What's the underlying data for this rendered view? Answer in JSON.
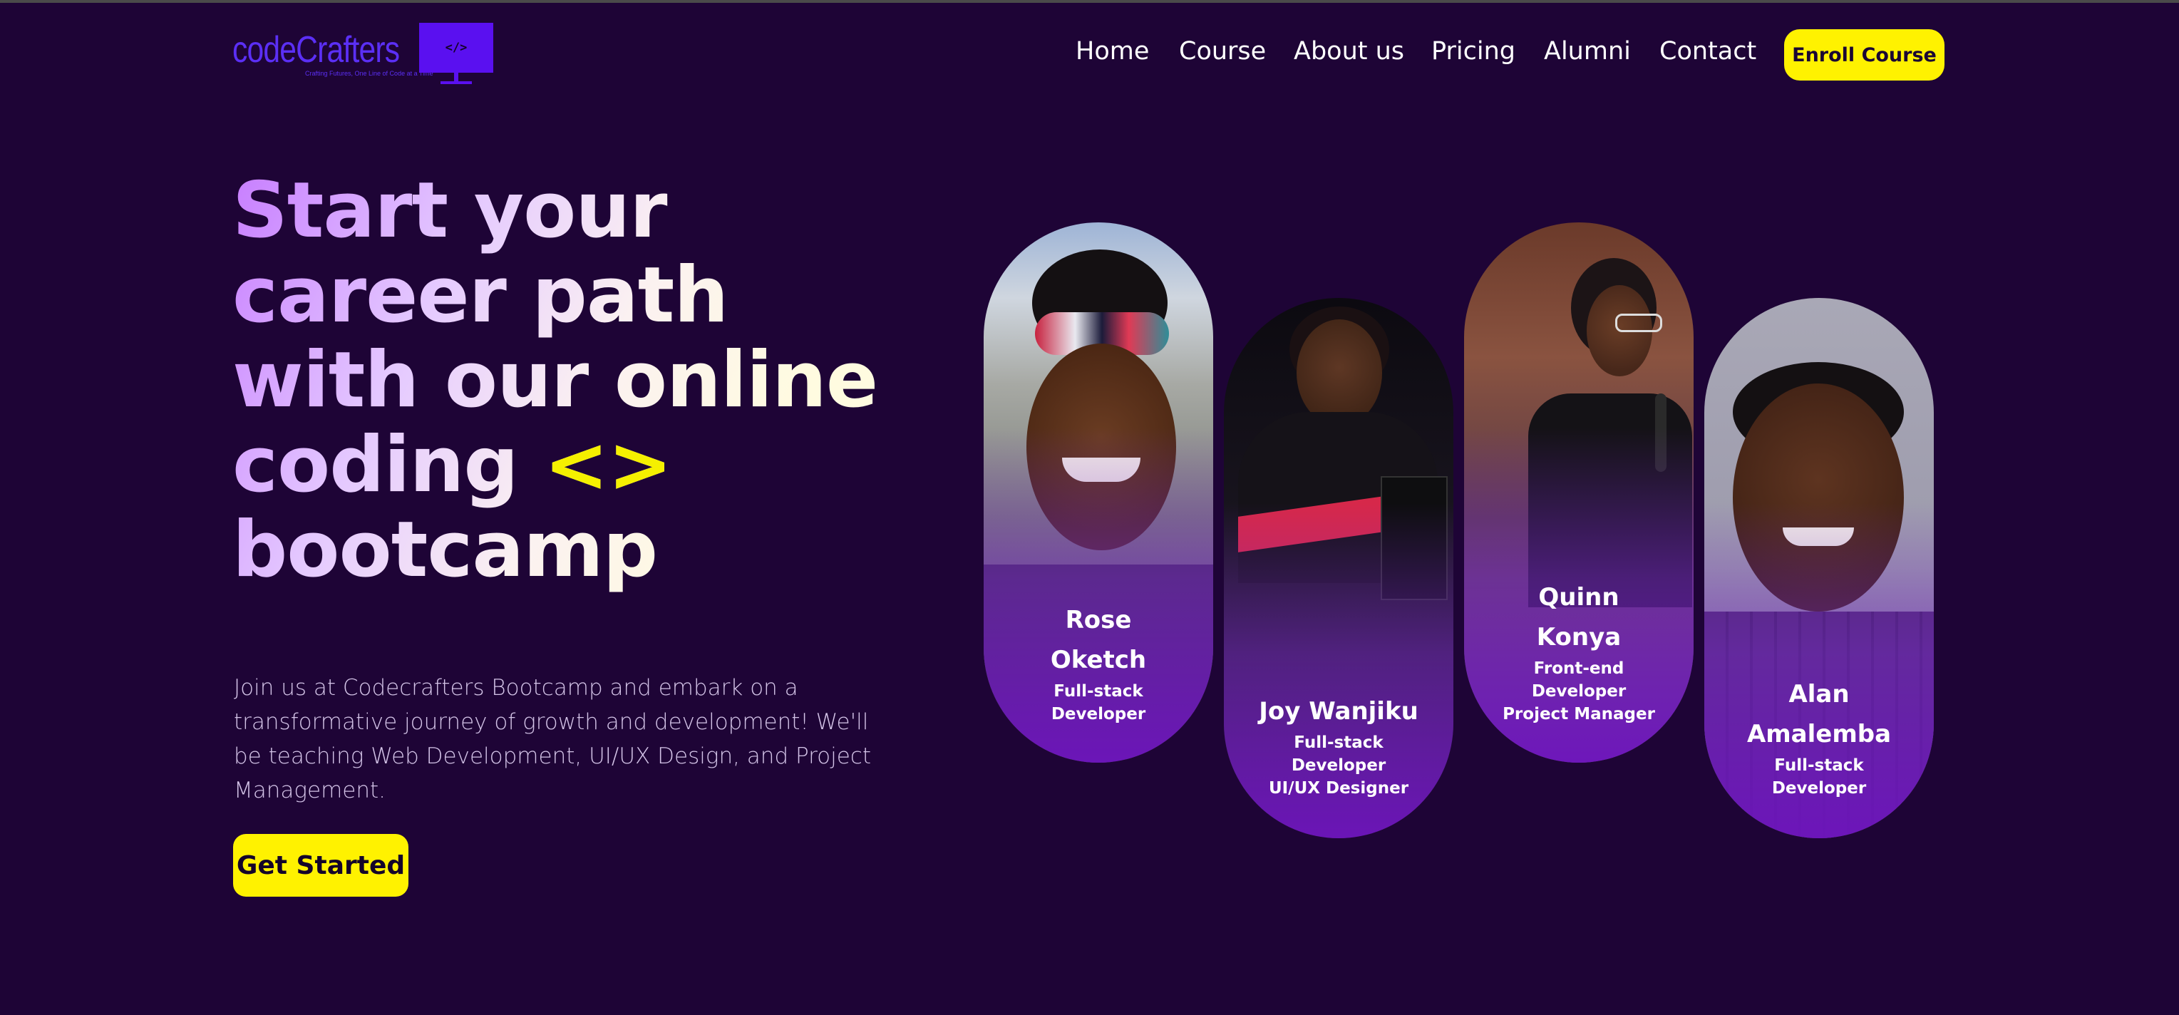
{
  "header": {
    "logo_text": "codeCrafters",
    "logo_tagline": "Crafting Futures, One Line of Code at a Time",
    "logo_symbol": "</>",
    "nav": [
      "Home",
      "Course",
      "About us",
      "Pricing",
      "Alumni",
      "Contact"
    ],
    "enroll_label": "Enroll Course"
  },
  "hero": {
    "headline_lines": [
      "Start your",
      "career path",
      "with our online",
      "coding",
      "bootcamp"
    ],
    "code_symbol": "<>",
    "intro": "Join us at Codecrafters Bootcamp and embark on a transformative journey of growth and development! We'll be teaching Web Development, UI/UX Design, and Project Management.",
    "cta_label": "Get Started"
  },
  "alumni": [
    {
      "name": "Rose Oketch",
      "roles": [
        "Full-stack",
        "Developer"
      ]
    },
    {
      "name": "Joy Wanjiku",
      "roles": [
        "Full-stack",
        "Developer",
        "UI/UX Designer"
      ]
    },
    {
      "name": "Quinn Konya",
      "roles": [
        "Front-end",
        "Developer",
        "Project Manager"
      ]
    },
    {
      "name": "Alan Amalemba",
      "roles": [
        "Full-stack",
        "Developer"
      ]
    }
  ],
  "colors": {
    "background": "#1e0436",
    "accent_yellow": "#fff200",
    "brand_purple": "#5b2ff5"
  }
}
